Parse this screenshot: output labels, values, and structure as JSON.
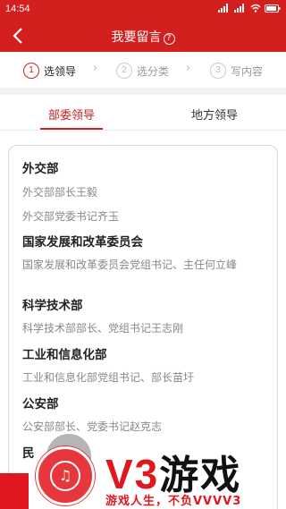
{
  "status_bar": {
    "time": "14:54",
    "signal": "▮▮▮",
    "battery": "▭"
  },
  "header": {
    "back_icon": "chevron-left-icon",
    "title": "我要留言",
    "help_glyph": "?"
  },
  "steps": [
    {
      "num": "1",
      "label": "选领导",
      "active": true
    },
    {
      "num": "2",
      "label": "选分类",
      "active": false
    },
    {
      "num": "3",
      "label": "写内容",
      "active": false
    }
  ],
  "tabs": [
    {
      "label": "部委领导",
      "active": true
    },
    {
      "label": "地方领导",
      "active": false
    }
  ],
  "departments": [
    {
      "name": "外交部",
      "leaders": [
        "外交部部长王毅",
        "外交部党委书记齐玉"
      ]
    },
    {
      "name": "国家发展和改革委员会",
      "leaders": [
        "国家发展和改革委员会党组书记、主任何立峰"
      ]
    },
    {
      "name": "科学技术部",
      "leaders": [
        "科学技术部部长、党组书记王志刚"
      ]
    },
    {
      "name": "工业和信息化部",
      "leaders": [
        "工业和信息化部党组书记、部长苗圩"
      ]
    },
    {
      "name": "公安部",
      "leaders": [
        "公安部部长、党委书记赵克志"
      ]
    },
    {
      "name": "民",
      "leaders": []
    }
  ],
  "promo": {
    "brand_v3": "V3",
    "brand_cn": "游戏",
    "slogan": "游戏人生，不负VVVV3",
    "accent": "#e0171f"
  },
  "colors": {
    "primary": "#d41f1f",
    "muted_text": "#888888"
  }
}
